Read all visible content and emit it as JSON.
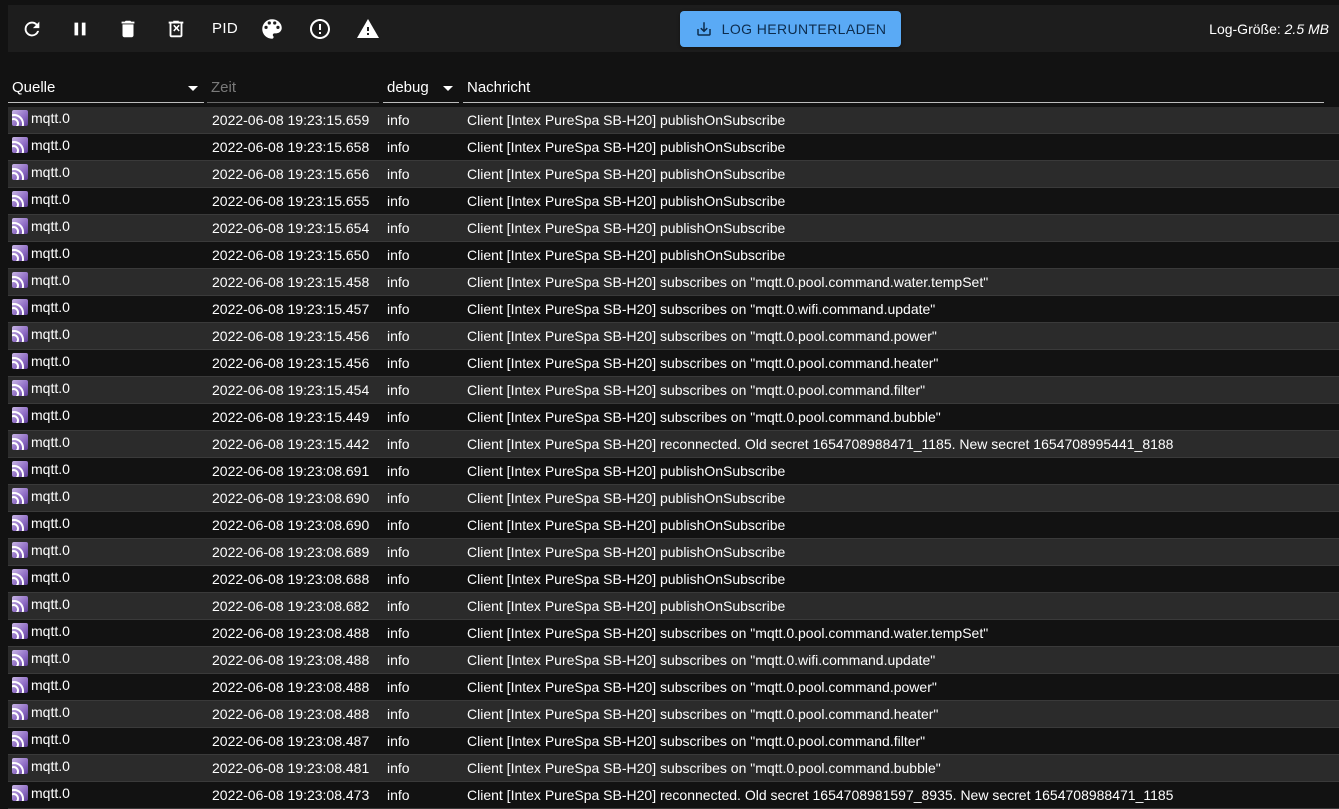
{
  "toolbar": {
    "pid_label": "PID",
    "download_label": "LOG HERUNTERLADEN",
    "logsize_label": "Log-Größe:",
    "logsize_value": "2.5 MB",
    "icons": [
      "refresh-icon",
      "pause-icon",
      "delete-icon",
      "delete-log-icon",
      "palette-icon",
      "warning-circle-icon",
      "warning-triangle-icon",
      "download-icon"
    ]
  },
  "columns": {
    "source": "Quelle",
    "time_placeholder": "Zeit",
    "level": "debug",
    "message": "Nachricht"
  },
  "rows": [
    {
      "source": "mqtt.0",
      "time": "2022-06-08 19:23:15.659",
      "level": "info",
      "message": "Client [Intex PureSpa SB-H20] publishOnSubscribe"
    },
    {
      "source": "mqtt.0",
      "time": "2022-06-08 19:23:15.658",
      "level": "info",
      "message": "Client [Intex PureSpa SB-H20] publishOnSubscribe"
    },
    {
      "source": "mqtt.0",
      "time": "2022-06-08 19:23:15.656",
      "level": "info",
      "message": "Client [Intex PureSpa SB-H20] publishOnSubscribe"
    },
    {
      "source": "mqtt.0",
      "time": "2022-06-08 19:23:15.655",
      "level": "info",
      "message": "Client [Intex PureSpa SB-H20] publishOnSubscribe"
    },
    {
      "source": "mqtt.0",
      "time": "2022-06-08 19:23:15.654",
      "level": "info",
      "message": "Client [Intex PureSpa SB-H20] publishOnSubscribe"
    },
    {
      "source": "mqtt.0",
      "time": "2022-06-08 19:23:15.650",
      "level": "info",
      "message": "Client [Intex PureSpa SB-H20] publishOnSubscribe"
    },
    {
      "source": "mqtt.0",
      "time": "2022-06-08 19:23:15.458",
      "level": "info",
      "message": "Client [Intex PureSpa SB-H20] subscribes on \"mqtt.0.pool.command.water.tempSet\""
    },
    {
      "source": "mqtt.0",
      "time": "2022-06-08 19:23:15.457",
      "level": "info",
      "message": "Client [Intex PureSpa SB-H20] subscribes on \"mqtt.0.wifi.command.update\""
    },
    {
      "source": "mqtt.0",
      "time": "2022-06-08 19:23:15.456",
      "level": "info",
      "message": "Client [Intex PureSpa SB-H20] subscribes on \"mqtt.0.pool.command.power\""
    },
    {
      "source": "mqtt.0",
      "time": "2022-06-08 19:23:15.456",
      "level": "info",
      "message": "Client [Intex PureSpa SB-H20] subscribes on \"mqtt.0.pool.command.heater\""
    },
    {
      "source": "mqtt.0",
      "time": "2022-06-08 19:23:15.454",
      "level": "info",
      "message": "Client [Intex PureSpa SB-H20] subscribes on \"mqtt.0.pool.command.filter\""
    },
    {
      "source": "mqtt.0",
      "time": "2022-06-08 19:23:15.449",
      "level": "info",
      "message": "Client [Intex PureSpa SB-H20] subscribes on \"mqtt.0.pool.command.bubble\""
    },
    {
      "source": "mqtt.0",
      "time": "2022-06-08 19:23:15.442",
      "level": "info",
      "message": "Client [Intex PureSpa SB-H20] reconnected. Old secret 1654708988471_1185. New secret 1654708995441_8188"
    },
    {
      "source": "mqtt.0",
      "time": "2022-06-08 19:23:08.691",
      "level": "info",
      "message": "Client [Intex PureSpa SB-H20] publishOnSubscribe"
    },
    {
      "source": "mqtt.0",
      "time": "2022-06-08 19:23:08.690",
      "level": "info",
      "message": "Client [Intex PureSpa SB-H20] publishOnSubscribe"
    },
    {
      "source": "mqtt.0",
      "time": "2022-06-08 19:23:08.690",
      "level": "info",
      "message": "Client [Intex PureSpa SB-H20] publishOnSubscribe"
    },
    {
      "source": "mqtt.0",
      "time": "2022-06-08 19:23:08.689",
      "level": "info",
      "message": "Client [Intex PureSpa SB-H20] publishOnSubscribe"
    },
    {
      "source": "mqtt.0",
      "time": "2022-06-08 19:23:08.688",
      "level": "info",
      "message": "Client [Intex PureSpa SB-H20] publishOnSubscribe"
    },
    {
      "source": "mqtt.0",
      "time": "2022-06-08 19:23:08.682",
      "level": "info",
      "message": "Client [Intex PureSpa SB-H20] publishOnSubscribe"
    },
    {
      "source": "mqtt.0",
      "time": "2022-06-08 19:23:08.488",
      "level": "info",
      "message": "Client [Intex PureSpa SB-H20] subscribes on \"mqtt.0.pool.command.water.tempSet\""
    },
    {
      "source": "mqtt.0",
      "time": "2022-06-08 19:23:08.488",
      "level": "info",
      "message": "Client [Intex PureSpa SB-H20] subscribes on \"mqtt.0.wifi.command.update\""
    },
    {
      "source": "mqtt.0",
      "time": "2022-06-08 19:23:08.488",
      "level": "info",
      "message": "Client [Intex PureSpa SB-H20] subscribes on \"mqtt.0.pool.command.power\""
    },
    {
      "source": "mqtt.0",
      "time": "2022-06-08 19:23:08.488",
      "level": "info",
      "message": "Client [Intex PureSpa SB-H20] subscribes on \"mqtt.0.pool.command.heater\""
    },
    {
      "source": "mqtt.0",
      "time": "2022-06-08 19:23:08.487",
      "level": "info",
      "message": "Client [Intex PureSpa SB-H20] subscribes on \"mqtt.0.pool.command.filter\""
    },
    {
      "source": "mqtt.0",
      "time": "2022-06-08 19:23:08.481",
      "level": "info",
      "message": "Client [Intex PureSpa SB-H20] subscribes on \"mqtt.0.pool.command.bubble\""
    },
    {
      "source": "mqtt.0",
      "time": "2022-06-08 19:23:08.473",
      "level": "info",
      "message": "Client [Intex PureSpa SB-H20] reconnected. Old secret 1654708981597_8935. New secret 1654708988471_1185"
    }
  ]
}
